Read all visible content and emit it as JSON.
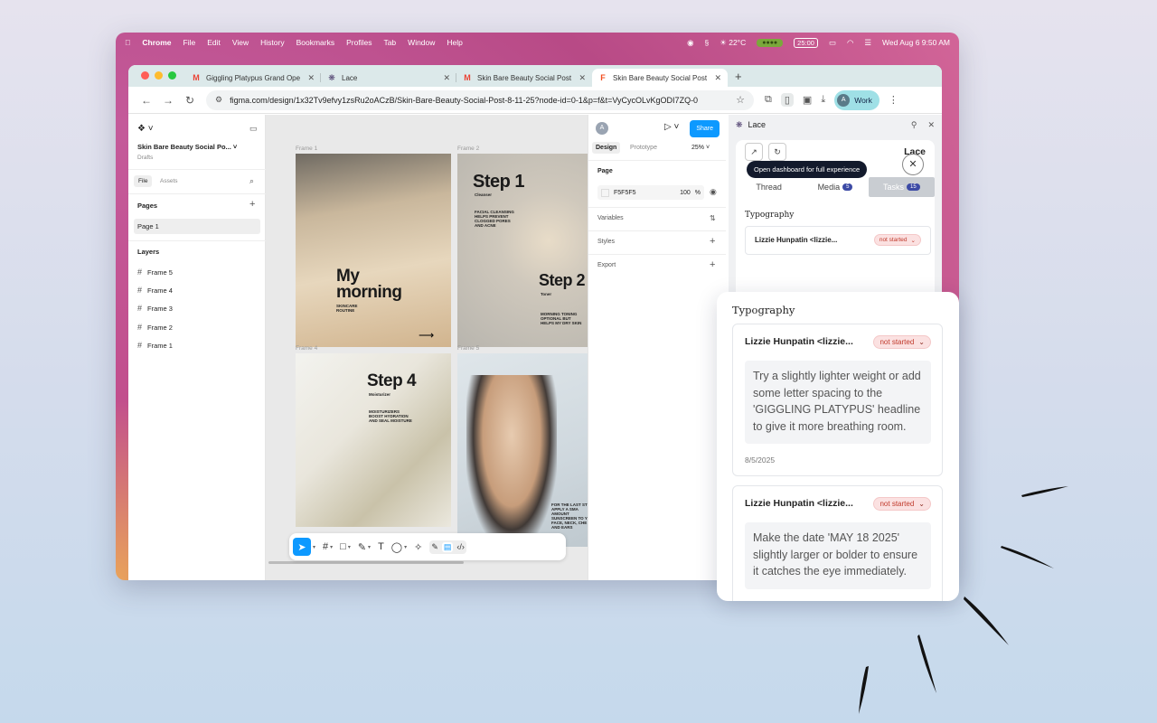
{
  "menubar": {
    "app": "Chrome",
    "items": [
      "File",
      "Edit",
      "View",
      "History",
      "Bookmarks",
      "Profiles",
      "Tab",
      "Window",
      "Help"
    ],
    "weather": "☀ 22°C",
    "timer": "25:00",
    "datetime": "Wed Aug 6  9:50 AM"
  },
  "browser": {
    "tabs": [
      {
        "title": "Giggling Platypus Grand Ope",
        "favicon": "M",
        "favicon_color": "#ea4335"
      },
      {
        "title": "Lace",
        "favicon": "❋",
        "favicon_color": "#4a3a6a"
      },
      {
        "title": "Skin Bare Beauty Social Post",
        "favicon": "M",
        "favicon_color": "#ea4335"
      },
      {
        "title": "Skin Bare Beauty Social Post",
        "favicon": "F",
        "favicon_color": "#f24e1e",
        "active": true
      }
    ],
    "url": "figma.com/design/1x32Tv9efvy1zsRu2oACzB/Skin-Bare-Beauty-Social-Post-8-11-25?node-id=0-1&p=f&t=VyCycOLvKgODI7ZQ-0",
    "profile_label": "Work",
    "profile_initial": "A"
  },
  "figma": {
    "file_name": "Skin Bare Beauty Social Po...",
    "file_location": "Drafts",
    "left_tabs": [
      "File",
      "Assets"
    ],
    "pages_label": "Pages",
    "pages": [
      "Page 1"
    ],
    "layers_label": "Layers",
    "layers": [
      "Frame 5",
      "Frame 4",
      "Frame 3",
      "Frame 2",
      "Frame 1"
    ],
    "frame_labels": [
      "Frame 1",
      "Frame 2",
      "Frame 4",
      "Frame 5"
    ],
    "frame1": {
      "headline1": "My",
      "headline2": "morning",
      "sub": "SKINCARE\nROUTINE"
    },
    "frame2": {
      "title": "Step 1",
      "sub": "Cleanser",
      "body": "FACIAL CLEANSING\nHELPS PREVENT\nCLOGGED PORES\nAND ACNE",
      "title2": "Step 2",
      "sub2": "Toner",
      "body2": "MORNING TONING\nOPTIONAL BUT\nHELPS MY DRY SKIN"
    },
    "frame4": {
      "title": "Step 4",
      "sub": "Moisturizer",
      "body": "MOISTURIZERS\nBOOST HYDRATION\nAND SEAL MOISTURE"
    },
    "frame5": {
      "body": "FOR THE LAST ST\nAPPLY A SMA\nAMOUNT\nSUNSCREEN TO YO\nFACE, NECK, CHE\nAND EARS"
    },
    "right_tabs": [
      "Design",
      "Prototype"
    ],
    "zoom": "25%",
    "share_label": "Share",
    "avatar_initial": "A",
    "page_section": "Page",
    "bg_hex": "F5F5F5",
    "bg_opacity": "100",
    "bg_pct": "%",
    "sections": [
      "Variables",
      "Styles",
      "Export"
    ]
  },
  "lace": {
    "panel_title": "Lace",
    "brand": "Lace",
    "dashboard_prompt": "Open dashboard for full experience",
    "tabs": [
      {
        "label": "Thread"
      },
      {
        "label": "Media",
        "count": "5"
      },
      {
        "label": "Tasks",
        "count": "15"
      }
    ],
    "section": "Typography",
    "mini_task_author": "Lizzie Hunpatin <lizzie...",
    "mini_task_status": "not started"
  },
  "popup": {
    "section": "Typography",
    "tasks": [
      {
        "author": "Lizzie Hunpatin <lizzie...",
        "status": "not started",
        "comment": "Try a slightly lighter weight or add some letter spacing to the 'GIGGLING PLATYPUS' headline to give it more breathing room.",
        "date": "8/5/2025"
      },
      {
        "author": "Lizzie Hunpatin <lizzie...",
        "status": "not started",
        "comment": "Make the date 'MAY 18 2025' slightly larger or bolder to ensure it catches the eye immediately."
      }
    ]
  },
  "colors": {
    "figma_blue": "#0d99ff",
    "status_red": "#c0392b",
    "status_bg": "#fbe1e1",
    "badge_blue": "#3c4aa5",
    "work_pill": "#9fe0e6"
  }
}
